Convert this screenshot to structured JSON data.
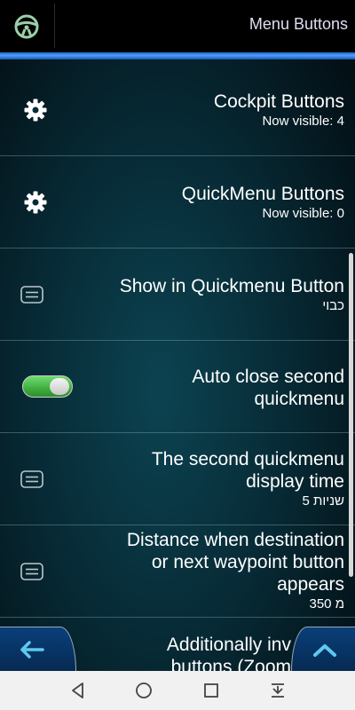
{
  "header": {
    "title": "Menu Buttons",
    "icon": "steering-wheel-icon"
  },
  "rows": [
    {
      "title": "Cockpit Buttons",
      "subtitle": "Now visible: 4",
      "icon": "gear-icon"
    },
    {
      "title": "QuickMenu Buttons",
      "subtitle": "Now visible: 0",
      "icon": "gear-icon"
    },
    {
      "title": "Show in Quickmenu Button",
      "subtitle": "כבוי",
      "icon": "list-icon"
    },
    {
      "title_lines": [
        "Auto close second",
        "quickmenu"
      ],
      "toggle_on": true,
      "icon": "toggle"
    },
    {
      "title_lines": [
        "The second quickmenu",
        "display time"
      ],
      "subtitle": "5 שניות",
      "icon": "list-icon"
    },
    {
      "title_lines": [
        "Distance when destination",
        "or next waypoint button",
        "appears"
      ],
      "subtitle": "350 מ",
      "icon": "list-icon"
    },
    {
      "title_lines": [
        "Additionally inv",
        "buttons (Zoom"
      ],
      "icon": "none"
    }
  ],
  "bottom_bar": {
    "back_icon": "back-arrow-icon",
    "up_icon": "chevron-up-icon"
  },
  "navbar": {
    "back": "nav-back-icon",
    "home": "nav-home-icon",
    "recents": "nav-recents-icon",
    "menu": "nav-menu-icon"
  },
  "colors": {
    "accent": "#3a8fe8",
    "arrow": "#5fc8f0",
    "toggle": "#4cbd4c"
  }
}
